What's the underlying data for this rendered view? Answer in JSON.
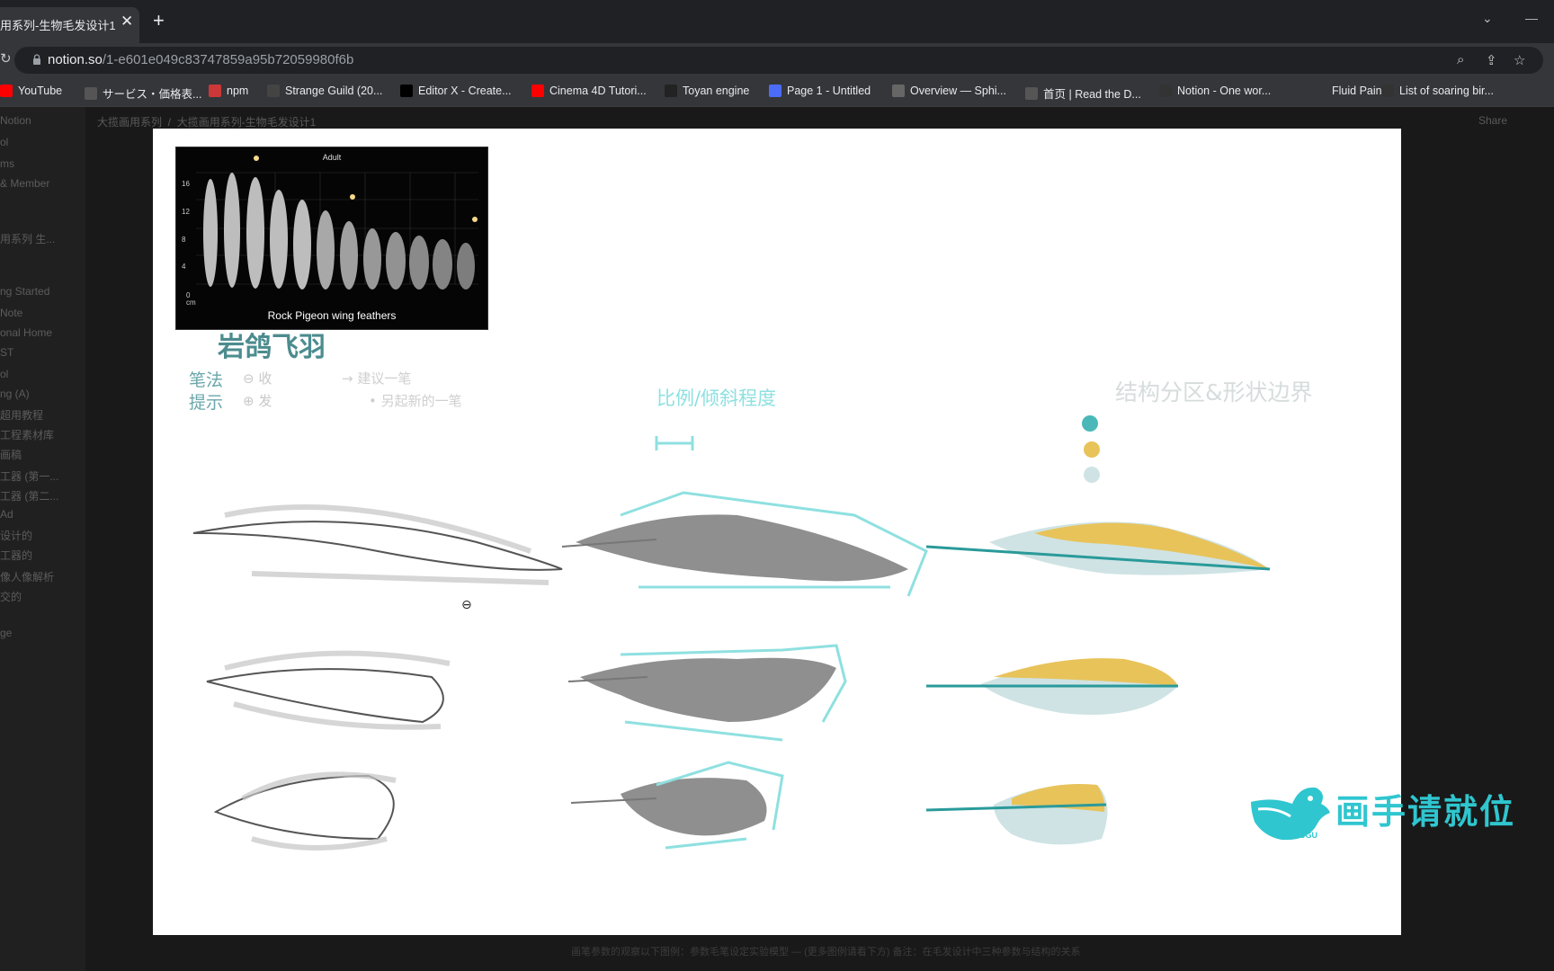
{
  "browser": {
    "tab_title": "用系列-生物毛发设计1",
    "tab_close": "✕",
    "new_tab": "+",
    "url_host": "notion.so",
    "url_path": "/1-e601e049c83747859a95b72059980f6b",
    "bookmarks": [
      {
        "label": "YouTube",
        "icon_color": "#ff0000"
      },
      {
        "label": "サービス・価格表...",
        "icon_color": "#555555"
      },
      {
        "label": "npm",
        "icon_color": "#cb3837"
      },
      {
        "label": "Strange Guild (20...",
        "icon_color": "#444444"
      },
      {
        "label": "Editor X - Create...",
        "icon_color": "#000000"
      },
      {
        "label": "Cinema 4D Tutori...",
        "icon_color": "#ff0000"
      },
      {
        "label": "Toyan engine",
        "icon_color": "#222222"
      },
      {
        "label": "Page 1 - Untitled",
        "icon_color": "#4a6cf7"
      },
      {
        "label": "Overview — Sphi...",
        "icon_color": "#666666"
      },
      {
        "label": "首页 | Read the D...",
        "icon_color": "#555555"
      },
      {
        "label": "Notion - One wor...",
        "icon_color": "#333333"
      },
      {
        "label": "Fluid Paint",
        "icon_color": "#35363a"
      },
      {
        "label": "List of soaring bir...",
        "icon_color": "#333333"
      }
    ]
  },
  "notion": {
    "workspace": "Notion",
    "sidebar_items": [
      "ol",
      "ms",
      "& Member",
      "用系列 生...",
      "ng Started",
      "Note",
      "onal Home",
      "ST",
      "ol",
      "ng (A)",
      "超用教程",
      "工程素材库",
      "画稿",
      "工器 (第一...",
      "工器 (第二...",
      "Ad",
      "设计的",
      "工器的",
      "像人像解析",
      "交的",
      "ge"
    ],
    "breadcrumb_1": "大揽画用系列",
    "breadcrumb_2": "大揽画用系列-生物毛发设计1",
    "share": "Share",
    "caption": "画笔参数的观察以下图例：参数毛笔设定实验模型 — (更多图例请看下方) 备注：在毛发设计中三种参数与结构的关系"
  },
  "canvas": {
    "photo": {
      "title": "Adult",
      "caption": "Rock Pigeon wing feathers",
      "y_ticks": [
        "16",
        "12",
        "8",
        "4",
        "0"
      ],
      "unit": "cm"
    },
    "heading": "岩鸽飞羽",
    "stroke_label_1": "笔法",
    "stroke_label_2": "提示",
    "minus_label": "⊖ 收",
    "plus_label": "⊕ 发",
    "arrow_note": "→ 建议一笔",
    "dot_note": "• 另起新的一笔",
    "proportion_note": "比例/倾斜程度",
    "structure_note": "结构分区&形状边界",
    "swatches": [
      "#4ab8b8",
      "#e8c35a",
      "#cfe3e4"
    ]
  },
  "watermark": {
    "text": "画手请就位",
    "brand": "BUGUGU",
    "color": "#2fc6cf"
  }
}
